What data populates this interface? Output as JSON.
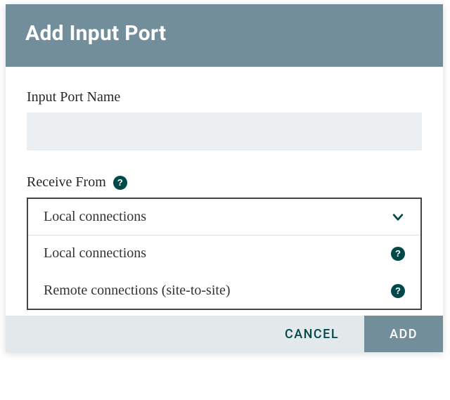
{
  "dialog": {
    "title": "Add Input Port",
    "fields": {
      "name": {
        "label": "Input Port Name",
        "value": "",
        "placeholder": ""
      },
      "receive": {
        "label": "Receive From",
        "selected": "Local connections",
        "options": [
          {
            "label": "Local connections"
          },
          {
            "label": "Remote connections (site-to-site)"
          }
        ]
      }
    },
    "buttons": {
      "cancel": "CANCEL",
      "add": "ADD"
    }
  },
  "colors": {
    "header_bg": "#728e9b",
    "accent_dark": "#004849",
    "input_bg": "#eceff1",
    "footer_bg": "#e3e8eb"
  }
}
